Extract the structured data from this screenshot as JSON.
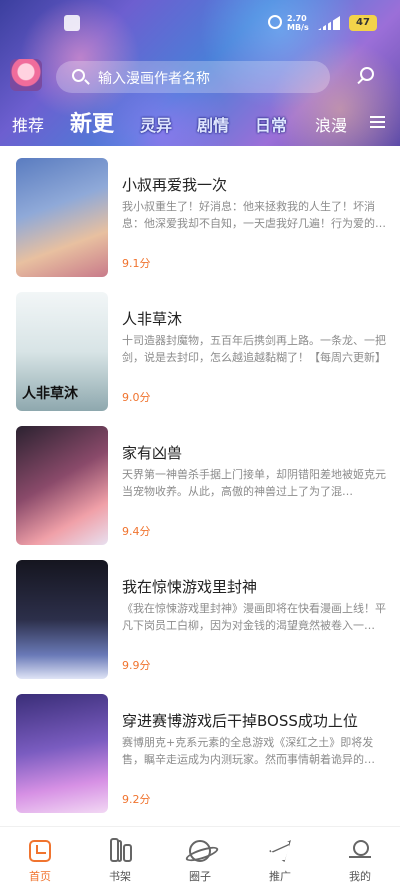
{
  "status_bar": {
    "speed": "2.70 MB/s",
    "battery": "47"
  },
  "search": {
    "placeholder": "输入漫画作者名称"
  },
  "tabs": [
    "推荐",
    "新更",
    "灵异",
    "剧情",
    "日常",
    "浪漫"
  ],
  "active_tab": "新更",
  "comics": [
    {
      "title": "小叔再爱我一次",
      "description": "我小叔重生了！好消息：他来拯救我的人生了！坏消息：他深爱我却不自知，一天虐我好几遍！行为爱的…",
      "score": "9.1分",
      "cover_color_a": "#6a8ec8",
      "cover_color_b": "#e8c0a0",
      "cover_text": ""
    },
    {
      "title": "人非草沐",
      "description": "十司造器封魔物，五百年后携剑再上路。一条龙、一把剑，说是去封印，怎么越追越黏糊了！【每周六更新】",
      "score": "9.0分",
      "cover_color_a": "#e8eef0",
      "cover_color_b": "#9fb4b8",
      "cover_text": "人非草沐"
    },
    {
      "title": "家有凶兽",
      "description": "天界第一神兽杀手据上门接单，却阴错阳差地被姬克元当宠物收养。从此，高傲的神兽过上了为了混…",
      "score": "9.4分",
      "cover_color_a": "#3a2a3e",
      "cover_color_b": "#e67a8a",
      "cover_text": ""
    },
    {
      "title": "我在惊悚游戏里封神",
      "description": "《我在惊悚游戏里封神》漫画即将在快看漫画上线！平凡下岗员工白柳，因为对金钱的渴望竟然被卷入一…",
      "score": "9.9分",
      "cover_color_a": "#1c1c2a",
      "cover_color_b": "#5a6aa8",
      "cover_text": ""
    },
    {
      "title": "穿进赛博游戏后干掉BOSS成功上位",
      "description": "赛博朋克+克系元素的全息游戏《深红之土》即将发售，瞩辛走运成为内测玩家。然而事情朝着诡异的…",
      "score": "9.2分",
      "cover_color_a": "#4a3a8a",
      "cover_color_b": "#d080e0",
      "cover_text": ""
    }
  ],
  "bottom_nav": [
    {
      "label": "首页",
      "icon": "home-icon",
      "active": true
    },
    {
      "label": "书架",
      "icon": "bookshelf-icon",
      "active": false
    },
    {
      "label": "圈子",
      "icon": "planet-icon",
      "active": false
    },
    {
      "label": "推广",
      "icon": "send-icon",
      "active": false
    },
    {
      "label": "我的",
      "icon": "profile-icon",
      "active": false
    }
  ],
  "colors": {
    "accent": "#f0742f",
    "text": "#222222",
    "muted": "#8c8c8c"
  }
}
